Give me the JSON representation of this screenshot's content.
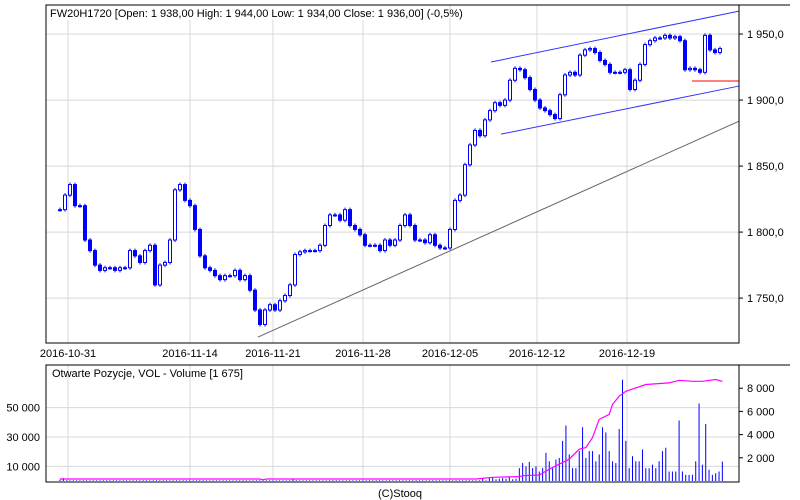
{
  "header": {
    "title": "FW20H1720 [Open: 1 938,00  High: 1 944,00  Low: 1 934,00  Close: 1 936,00] (-0,5%)"
  },
  "footer": {
    "copyright": "(C)Stooq"
  },
  "colors": {
    "price": "#0000ff",
    "trend": "#666666",
    "channel": "#3333ff",
    "support": "#ff0000",
    "oi": "#ff00ff",
    "volume": "#0000ff",
    "grid": "#d8d8d8"
  },
  "chart_data": [
    {
      "type": "line",
      "name": "price",
      "ylim": [
        1716,
        1972
      ],
      "xlim": [
        -2.8,
        135.8
      ],
      "yticks": [
        {
          "value": 1950,
          "label": "1 950,0"
        },
        {
          "value": 1900,
          "label": "1 900,0"
        },
        {
          "value": 1850,
          "label": "1 850,0"
        },
        {
          "value": 1800,
          "label": "1 800,0"
        },
        {
          "value": 1750,
          "label": "1 750,0"
        }
      ],
      "xticks": [
        {
          "index": 1.6,
          "label": "2016-10-31"
        },
        {
          "index": 26,
          "label": "2016-11-14"
        },
        {
          "index": 42.6,
          "label": "2016-11-21"
        },
        {
          "index": 60.6,
          "label": "2016-11-28"
        },
        {
          "index": 78,
          "label": "2016-12-05"
        },
        {
          "index": 95.4,
          "label": "2016-12-12"
        },
        {
          "index": 113.4,
          "label": "2016-12-19"
        }
      ],
      "close": [
        1817,
        1828,
        1836,
        1820,
        1820,
        1794,
        1786,
        1775,
        1771,
        1773,
        1773,
        1771,
        1773,
        1773,
        1786,
        1782,
        1777,
        1786,
        1790,
        1760,
        1775,
        1777,
        1794,
        1832,
        1836,
        1824,
        1820,
        1802,
        1782,
        1773,
        1771,
        1767,
        1764,
        1767,
        1767,
        1771,
        1764,
        1767,
        1756,
        1741,
        1730,
        1741,
        1745,
        1741,
        1748,
        1752,
        1760,
        1783,
        1785,
        1786,
        1786,
        1786,
        1790,
        1805,
        1813,
        1813,
        1809,
        1817,
        1805,
        1802,
        1798,
        1790,
        1790,
        1790,
        1786,
        1794,
        1790,
        1794,
        1805,
        1813,
        1805,
        1794,
        1794,
        1792,
        1798,
        1790,
        1788,
        1788,
        1802,
        1824,
        1828,
        1851,
        1866,
        1877,
        1873,
        1885,
        1892,
        1898,
        1896,
        1900,
        1915,
        1924,
        1923,
        1917,
        1908,
        1900,
        1894,
        1892,
        1889,
        1886,
        1904,
        1919,
        1921,
        1919,
        1934,
        1938,
        1939,
        1936,
        1930,
        1927,
        1921,
        1921,
        1921,
        1923,
        1908,
        1915,
        1927,
        1942,
        1945,
        1947,
        1947,
        1949,
        1947,
        1948,
        1945,
        1923,
        1924,
        1923,
        1921,
        1949,
        1938,
        1936,
        1939
      ],
      "lines": [
        {
          "name": "trend-line",
          "color": "#666666",
          "from": [
            39.6,
            1720.5
          ],
          "to": [
            135.8,
            1884
          ]
        },
        {
          "name": "channel-upper-line",
          "color": "#3333ff",
          "from": [
            86.2,
            1928.8
          ],
          "to": [
            135.8,
            1967.4
          ]
        },
        {
          "name": "channel-lower-line",
          "color": "#3333ff",
          "from": [
            88.2,
            1874.2
          ],
          "to": [
            135.8,
            1910.6
          ]
        },
        {
          "name": "support-line",
          "color": "#ff0000",
          "from": [
            126.4,
            1914.4
          ],
          "to": [
            135.8,
            1914.4
          ]
        }
      ]
    },
    {
      "type": "bar",
      "name": "volume-and-open-interest",
      "title": "Otwarte Pozycje, VOL - Volume [1 675]",
      "xlim": [
        -4.2,
        204
      ],
      "volume_ylim": [
        0,
        10000
      ],
      "oi_ylim": [
        0,
        79100
      ],
      "volume_ticks": [
        {
          "value": 8000,
          "label": "8 000"
        },
        {
          "value": 6000,
          "label": "6 000"
        },
        {
          "value": 4000,
          "label": "4 000"
        },
        {
          "value": 2000,
          "label": "2 000"
        }
      ],
      "oi_ticks": [
        {
          "value": 50000,
          "label": "50 000"
        },
        {
          "value": 30000,
          "label": "30 000"
        },
        {
          "value": 10000,
          "label": "10 000"
        }
      ],
      "volume": [
        120,
        250,
        60,
        60,
        60,
        60,
        60,
        60,
        60,
        60,
        60,
        60,
        60,
        60,
        60,
        60,
        60,
        60,
        60,
        60,
        60,
        60,
        60,
        60,
        60,
        60,
        60,
        60,
        60,
        60,
        60,
        60,
        60,
        60,
        60,
        60,
        60,
        60,
        60,
        60,
        60,
        60,
        60,
        60,
        60,
        60,
        60,
        60,
        60,
        60,
        60,
        60,
        60,
        60,
        60,
        60,
        60,
        60,
        60,
        60,
        60,
        60,
        60,
        60,
        60,
        60,
        60,
        60,
        60,
        60,
        150,
        60,
        60,
        60,
        60,
        60,
        60,
        60,
        60,
        60,
        60,
        60,
        60,
        60,
        60,
        60,
        60,
        60,
        60,
        60,
        60,
        60,
        60,
        60,
        60,
        60,
        60,
        60,
        60,
        60,
        60,
        60,
        60,
        60,
        60,
        60,
        60,
        60,
        60,
        60,
        60,
        60,
        60,
        60,
        60,
        60,
        60,
        60,
        60,
        60,
        60,
        60,
        60,
        60,
        60,
        60,
        60,
        200,
        60,
        300,
        300,
        150,
        200,
        250,
        200,
        300,
        150,
        200,
        1110,
        1550,
        1260,
        1640,
        1110,
        1260,
        820,
        1110,
        2430,
        1700,
        1110,
        1850,
        1990,
        3460,
        4780,
        2290,
        1110,
        1110,
        2580,
        4630,
        1990,
        2580,
        2580,
        1700,
        2290,
        4630,
        4190,
        2580,
        1700,
        1550,
        4480,
        8730,
        3460,
        1110,
        2140,
        1700,
        1700,
        2720,
        1110,
        1110,
        1410,
        1110,
        1700,
        2580,
        2870,
        820,
        820,
        820,
        5220,
        820,
        530,
        530,
        530,
        1700,
        6680,
        1410,
        4920,
        970,
        530,
        670,
        820,
        1675
      ],
      "open_interest": [
        [
          0,
          1360
        ],
        [
          60,
          1360
        ],
        [
          61,
          800
        ],
        [
          62,
          1360
        ],
        [
          125,
          1360
        ],
        [
          130,
          2500
        ],
        [
          138,
          3000
        ],
        [
          139,
          3600
        ],
        [
          144,
          4070
        ],
        [
          147,
          8140
        ],
        [
          152,
          13800
        ],
        [
          153,
          14900
        ],
        [
          156,
          21700
        ],
        [
          158,
          22800
        ],
        [
          160,
          29600
        ],
        [
          162,
          42000
        ],
        [
          165,
          45400
        ],
        [
          166,
          52200
        ],
        [
          168,
          57800
        ],
        [
          170,
          61200
        ],
        [
          173,
          63500
        ],
        [
          176,
          65800
        ],
        [
          183,
          66900
        ],
        [
          186,
          68700
        ],
        [
          190,
          68000
        ],
        [
          193,
          68000
        ],
        [
          197,
          69200
        ],
        [
          199,
          68000
        ]
      ]
    }
  ]
}
